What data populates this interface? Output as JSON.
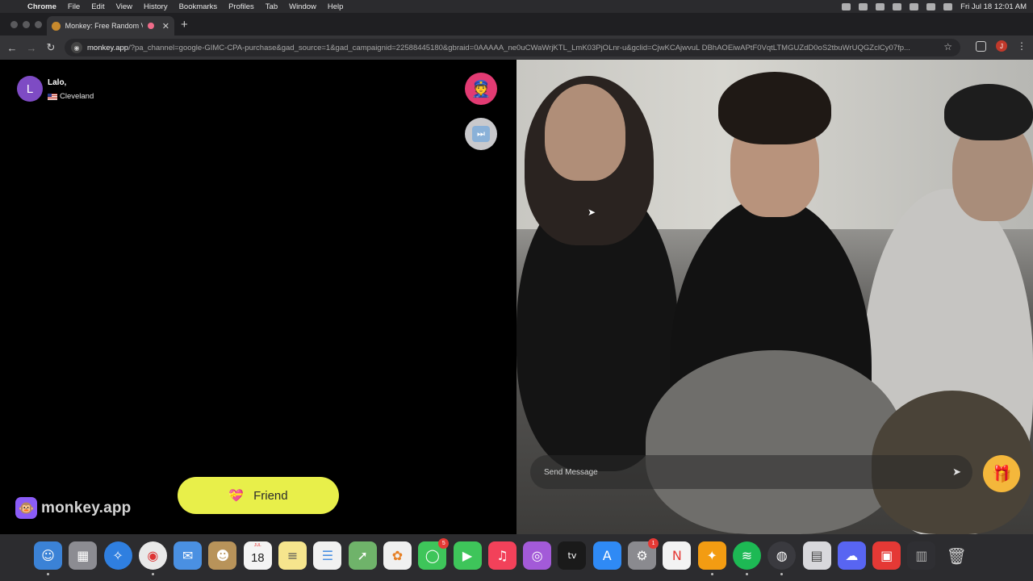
{
  "menubar": {
    "app": "Chrome",
    "items": [
      "File",
      "Edit",
      "View",
      "History",
      "Bookmarks",
      "Profiles",
      "Tab",
      "Window",
      "Help"
    ],
    "clock": "Fri Jul 18  12:01 AM"
  },
  "tab": {
    "title": "Monkey: Free Random Vi"
  },
  "omnibox": {
    "host": "monkey.app",
    "path": "/?pa_channel=google-GIMC-CPA-purchase&gad_source=1&gad_campaignid=22588445180&gbraid=0AAAAA_ne0uCWaWrjKTL_LmK03PjOLnr-u&gclid=CjwKCAjwvuL DBhAOEiwAPtF0VqtLTMGUZdD0oS2tbuWrUQGZclCy07fp..."
  },
  "profile_initial": "J",
  "user": {
    "initial": "L",
    "name": "Lalo,",
    "location": "Cleveland"
  },
  "brand": {
    "name": "monkey.app"
  },
  "friend_button": {
    "label": "Friend"
  },
  "chat": {
    "placeholder": "Send Message"
  },
  "dock": {
    "calendar_month": "JUL",
    "calendar_day": "18",
    "messages_badge": "5",
    "settings_badge": "1",
    "tv_label": "tv"
  },
  "colors": {
    "friend_button": "#e8ef4a",
    "police_button": "#e23b73",
    "avatar": "#7e4bc4",
    "gift_button": "#f4b73b"
  }
}
